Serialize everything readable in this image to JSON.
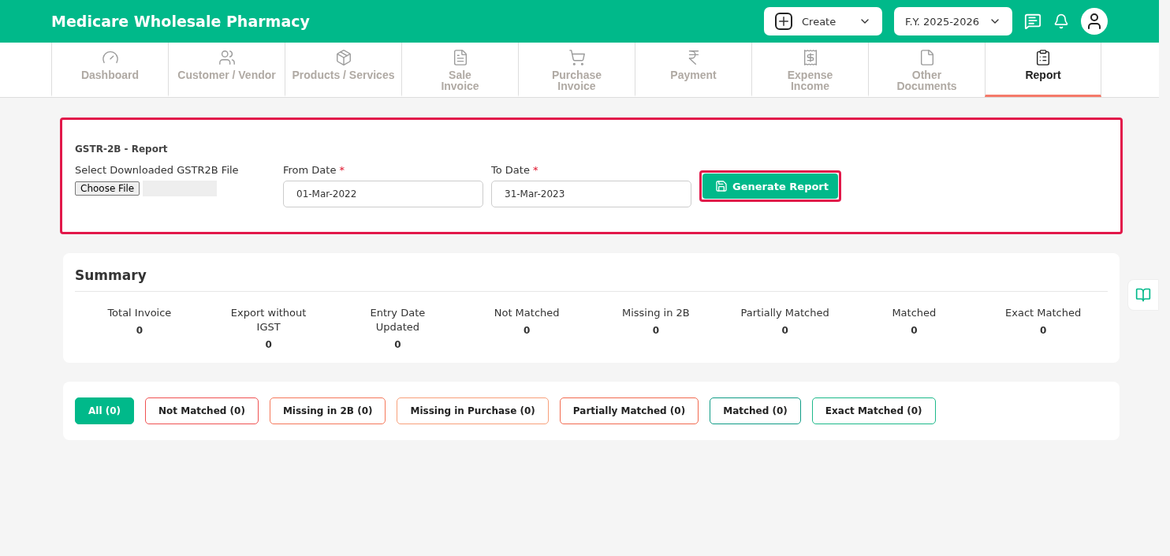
{
  "header": {
    "title": "Medicare Wholesale Pharmacy",
    "create_label": "Create",
    "fiscal_year": "F.Y. 2025-2026"
  },
  "nav_tabs": [
    {
      "label": "Dashboard",
      "selected": false
    },
    {
      "label": "Customer / Vendor",
      "selected": false
    },
    {
      "label": "Products / Services",
      "selected": false
    },
    {
      "label": "Sale\nInvoice",
      "selected": false
    },
    {
      "label": "Purchase\nInvoice",
      "selected": false
    },
    {
      "label": "Payment",
      "selected": false
    },
    {
      "label": "Expense\nIncome",
      "selected": false
    },
    {
      "label": "Other\nDocuments",
      "selected": false
    },
    {
      "label": "Report",
      "selected": true
    }
  ],
  "report_form": {
    "title": "GSTR-2B - Report",
    "file_label": "Select Downloaded GSTR2B File",
    "file_button": "Choose File",
    "from_label": "From Date",
    "from_value": "01-Mar-2022",
    "to_label": "To Date",
    "to_value": "31-Mar-2023",
    "required_mark": "*",
    "generate_button": "Generate Report"
  },
  "summary": {
    "title": "Summary",
    "stats": [
      {
        "label": "Total Invoice",
        "value": "0"
      },
      {
        "label": "Export without IGST",
        "value": "0"
      },
      {
        "label": "Entry Date Updated",
        "value": "0"
      },
      {
        "label": "Not Matched",
        "value": "0"
      },
      {
        "label": "Missing in 2B",
        "value": "0"
      },
      {
        "label": "Partially Matched",
        "value": "0"
      },
      {
        "label": "Matched",
        "value": "0"
      },
      {
        "label": "Exact Matched",
        "value": "0"
      }
    ]
  },
  "filters": [
    {
      "label": "All (0)",
      "selected": true,
      "color": "#00b98a"
    },
    {
      "label": "Not Matched (0)",
      "selected": false,
      "color": "#f05252"
    },
    {
      "label": "Missing in 2B (0)",
      "selected": false,
      "color": "#f5785a"
    },
    {
      "label": "Missing in Purchase (0)",
      "selected": false,
      "color": "#f8a07a"
    },
    {
      "label": "Partially Matched (0)",
      "selected": false,
      "color": "#f26a4f"
    },
    {
      "label": "Matched (0)",
      "selected": false,
      "color": "#0f9c86"
    },
    {
      "label": "Exact Matched (0)",
      "selected": false,
      "color": "#1cb98a"
    }
  ]
}
